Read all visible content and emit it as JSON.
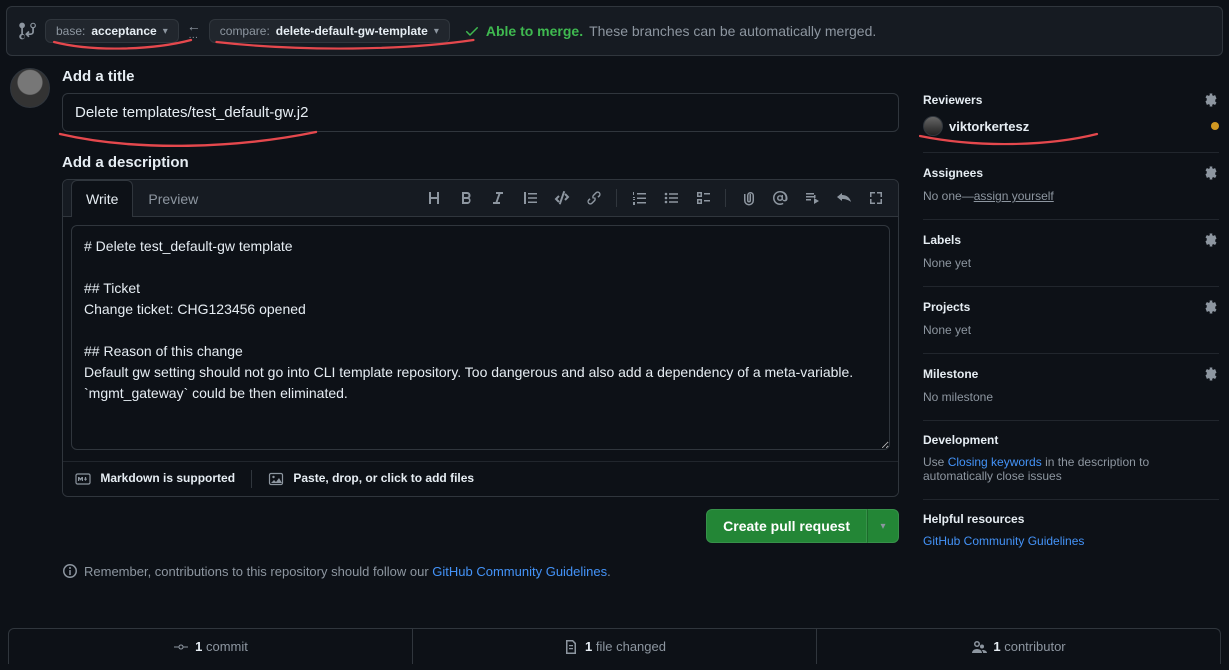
{
  "mergebar": {
    "base_prefix": "base:",
    "base_branch": "acceptance",
    "compare_prefix": "compare:",
    "compare_branch": "delete-default-gw-template",
    "status_able": "Able to merge.",
    "status_msg": "These branches can be automatically merged."
  },
  "form": {
    "title_heading": "Add a title",
    "title_value": "Delete templates/test_default-gw.j2",
    "desc_heading": "Add a description",
    "tabs": {
      "write": "Write",
      "preview": "Preview"
    },
    "body": "# Delete test_default-gw template\n\n## Ticket\nChange ticket: CHG123456 opened\n\n## Reason of this change\nDefault gw setting should not go into CLI template repository. Too dangerous and also add a dependency of a meta-variable. `mgmt_gateway` could be then eliminated.",
    "footer_md": "Markdown is supported",
    "footer_attach": "Paste, drop, or click to add files",
    "create_btn": "Create pull request",
    "remember_prefix": "Remember, contributions to this repository should follow our ",
    "remember_link": "GitHub Community Guidelines"
  },
  "sidebar": {
    "reviewers": {
      "heading": "Reviewers",
      "name": "viktorkertesz"
    },
    "assignees": {
      "heading": "Assignees",
      "none_prefix": "No one—",
      "assign": "assign yourself"
    },
    "labels": {
      "heading": "Labels",
      "body": "None yet"
    },
    "projects": {
      "heading": "Projects",
      "body": "None yet"
    },
    "milestone": {
      "heading": "Milestone",
      "body": "No milestone"
    },
    "development": {
      "heading": "Development",
      "prefix": "Use ",
      "link": "Closing keywords",
      "suffix": " in the description to automatically close issues"
    },
    "helpful": {
      "heading": "Helpful resources",
      "link": "GitHub Community Guidelines"
    }
  },
  "stats": {
    "commits_n": "1",
    "commits_label": "commit",
    "files_n": "1",
    "files_label": "file changed",
    "contrib_n": "1",
    "contrib_label": "contributor"
  }
}
